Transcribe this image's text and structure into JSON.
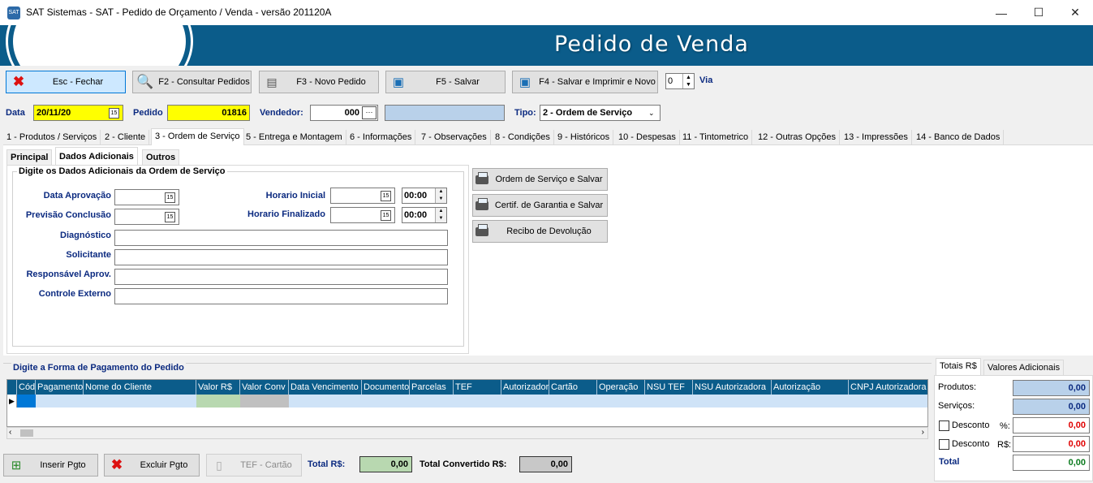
{
  "window": {
    "title": "SAT Sistemas - SAT - Pedido de Orçamento / Venda - versão 201120A",
    "icon": "app-icon",
    "controls": {
      "minimize": "—",
      "maximize": "☐",
      "close": "✕"
    }
  },
  "banner": {
    "title": "Pedido de Venda"
  },
  "toolbar": {
    "esc_label": "Esc - Fechar",
    "f2_label": "F2 - Consultar Pedidos",
    "f3_label": "F3 - Novo Pedido",
    "f5_label": "F5 - Salvar",
    "f4_label": "F4 - Salvar e Imprimir e Novo",
    "via_value": "0",
    "via_label": "Via"
  },
  "header": {
    "data_label": "Data",
    "data_value": "20/11/20",
    "pedido_label": "Pedido",
    "pedido_value": "01816",
    "vendedor_label": "Vendedor:",
    "vendedor_code": "000",
    "vendedor_btn": "···",
    "vendedor_name": "",
    "tipo_label": "Tipo:",
    "tipo_value": "2 - Ordem de Serviço"
  },
  "tabs": [
    "1 - Produtos / Serviços",
    "2 - Cliente",
    "3 - Ordem de Serviço",
    "5 - Entrega e Montagem",
    "6 - Informações",
    "7 - Observações",
    "8 - Condições",
    "9 - Históricos",
    "10 - Despesas",
    "11 - Tintometrico",
    "12 - Outras Opções",
    "13 - Impressões",
    "14 - Banco de Dados"
  ],
  "subtabs": [
    "Principal",
    "Dados Adicionais",
    "Outros"
  ],
  "os_group": {
    "title": "Digite os Dados Adicionais da Ordem de Serviço",
    "data_aprovacao": "Data Aprovação",
    "previsao_conclusao": "Previsão Conclusão",
    "horario_inicial": "Horario Inicial",
    "horario_inicial_value": "00:00",
    "horario_finalizado": "Horario Finalizado",
    "horario_finalizado_value": "00:00",
    "diagnostico": "Diagnóstico",
    "solicitante": "Solicitante",
    "responsavel": "Responsável Aprov.",
    "controle_externo": "Controle Externo"
  },
  "side_buttons": {
    "os_salvar": "Ordem de Serviço e Salvar",
    "certif_salvar": "Certif. de Garantia e Salvar",
    "recibo": "Recibo de Devolução"
  },
  "payment": {
    "title": "Digite a Forma de Pagamento do Pedido",
    "columns": [
      "Cód",
      "Pagamento",
      "Nome do Cliente",
      "Valor R$",
      "Valor Conv",
      "Data Vencimento",
      "Documento",
      "Parcelas",
      "TEF",
      "Autorizador",
      "Cartão",
      "Operação",
      "NSU TEF",
      "NSU Autorizadora",
      "Autorização",
      "CNPJ Autorizadora"
    ]
  },
  "totals": {
    "tabs": [
      "Totais R$",
      "Valores Adicionais"
    ],
    "produtos_label": "Produtos:",
    "produtos_value": "0,00",
    "servicos_label": "Serviços:",
    "servicos_value": "0,00",
    "desconto_label": "Desconto",
    "pct_label": "%:",
    "desconto_pct_value": "0,00",
    "rs_label": "R$:",
    "desconto_rs_value": "0,00",
    "total_label": "Total",
    "total_value": "0,00"
  },
  "bottom": {
    "inserir_label": "Inserir Pgto",
    "excluir_label": "Excluir Pgto",
    "tef_label": "TEF - Cartão",
    "total_label": "Total R$:",
    "total_value": "0,00",
    "total_conv_label": "Total Convertido R$:",
    "total_conv_value": "0,00"
  }
}
